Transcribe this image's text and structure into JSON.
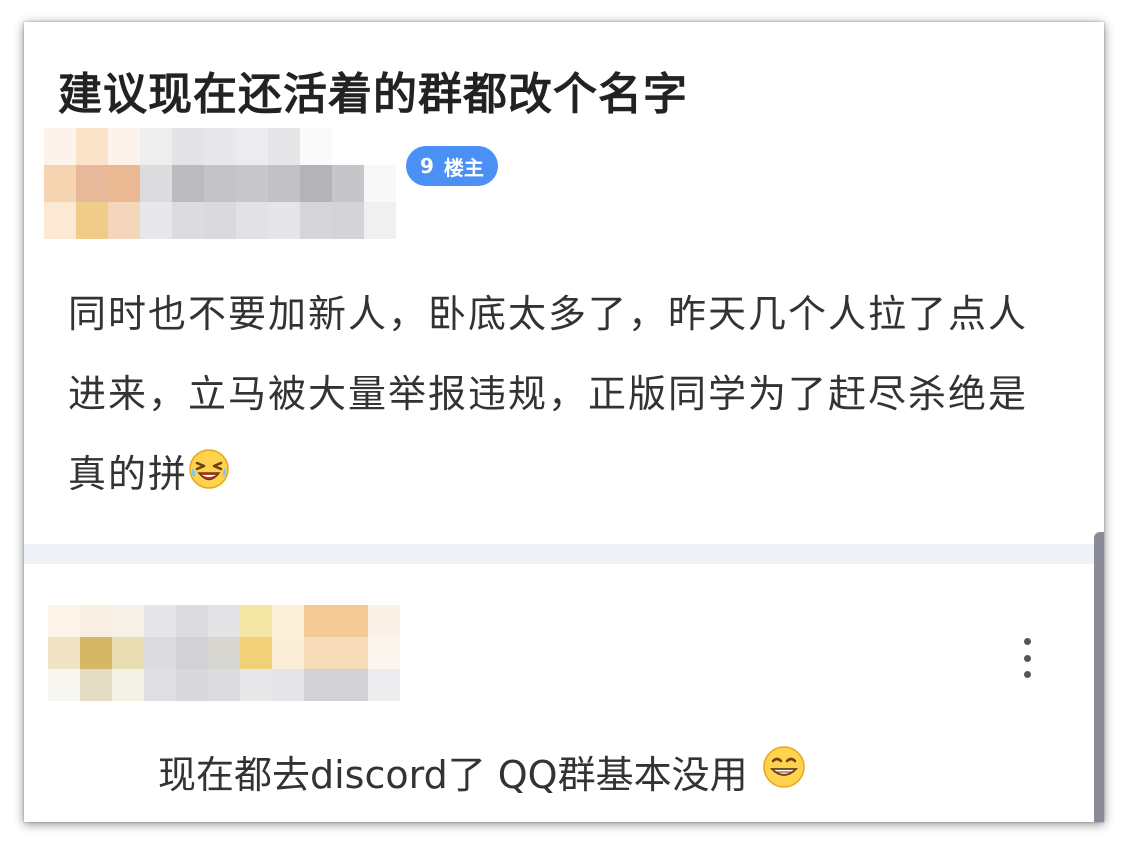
{
  "post": {
    "title": "建议现在还活着的群都改个名字",
    "author_badge": {
      "floor": "9",
      "label": "楼主"
    },
    "body": "同时也不要加新人，卧底太多了，昨天几个人拉了点人进来，立马被大量举报违规，正版同学为了赶尽杀绝是真的拼",
    "body_emoji": "laughing-tears-emoji"
  },
  "reply": {
    "text": "现在都去discord了 QQ群基本没用",
    "emoji": "grinning-emoji",
    "menu_icon": "more-vertical-icon"
  },
  "blurred_names": {
    "op_colors": [
      "#fdf3ea",
      "#fbe3c9",
      "#fdf3ea",
      "#eeeeee",
      "#e4e4e6",
      "#e8e8ea",
      "#ececee",
      "#e6e6e8",
      "#fafafa",
      "#ffffff",
      "#ffffff",
      "#f6d3b1",
      "#e7b99a",
      "#eab892",
      "#dcdcde",
      "#bcbcc0",
      "#c4c4c8",
      "#c8c8cc",
      "#c2c2c6",
      "#b4b4b8",
      "#c6c6ca",
      "#f8f8f8",
      "#fbe9d4",
      "#efcd89",
      "#f4d6bc",
      "#e8e8ea",
      "#dcdcde",
      "#dadadc",
      "#e2e2e4",
      "#e6e6e8",
      "#d6d6da",
      "#d4d4d8",
      "#f0f0f0"
    ],
    "reply_colors": [
      "#fdf5ea",
      "#f6efe2",
      "#f7f2e8",
      "#e6e6e8",
      "#dcdcde",
      "#e4e4e6",
      "#f4e7a6",
      "#fcefd8",
      "#f5c994",
      "#f5c994",
      "#fbf1e6",
      "#ffffff",
      "#f1e4c6",
      "#d5b766",
      "#e9ddb2",
      "#dcdcde",
      "#d2d2d4",
      "#d8d6d0",
      "#f0d178",
      "#faeed9",
      "#f8dbb8",
      "#f8dbb8",
      "#fdf6ef",
      "#ffffff",
      "#f8f6f0",
      "#e4dcc4",
      "#f3f0e6",
      "#e0e0e4",
      "#d8d8dc",
      "#dcdce0",
      "#e8e8ea",
      "#e6e6ea",
      "#d2d2d6",
      "#d2d2d6",
      "#ededef",
      "#ffffff"
    ]
  }
}
